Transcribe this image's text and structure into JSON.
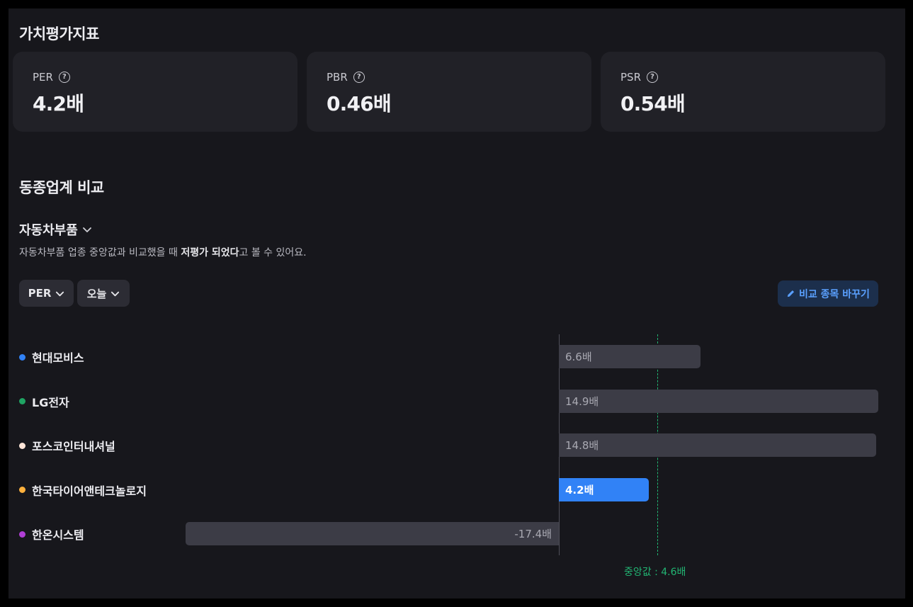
{
  "valuation": {
    "title": "가치평가지표",
    "cards": [
      {
        "label": "PER",
        "value": "4.2배"
      },
      {
        "label": "PBR",
        "value": "0.46배"
      },
      {
        "label": "PSR",
        "value": "0.54배"
      }
    ]
  },
  "peers": {
    "title": "동종업계 비교",
    "industry": "자동차부품",
    "description_prefix": "자동차부품 업종 중앙값과 비교했을 때 ",
    "description_bold": "저평가 되었다",
    "description_suffix": "고 볼 수 있어요.",
    "metric_select": "PER",
    "period_select": "오늘",
    "compare_button": "비교 종목 바꾸기",
    "median_label": "중앙값 : 4.6배",
    "colors": {
      "accent": "#3182f6",
      "median": "#22b573"
    }
  },
  "chart_data": {
    "type": "bar",
    "orientation": "horizontal",
    "categories": [
      "현대모비스",
      "LG전자",
      "포스코인터내셔널",
      "한국타이어앤테크놀로지",
      "한온시스템"
    ],
    "values": [
      6.6,
      14.9,
      14.8,
      4.2,
      -17.4
    ],
    "value_labels": [
      "6.6배",
      "14.9배",
      "14.8배",
      "4.2배",
      "-17.4배"
    ],
    "dot_colors": [
      "#3182f6",
      "#1fa463",
      "#fde5d8",
      "#ffb13d",
      "#b13fd6"
    ],
    "highlight_index": 3,
    "median": 4.6,
    "xlim": [
      -17.4,
      14.9
    ],
    "grid": false
  }
}
